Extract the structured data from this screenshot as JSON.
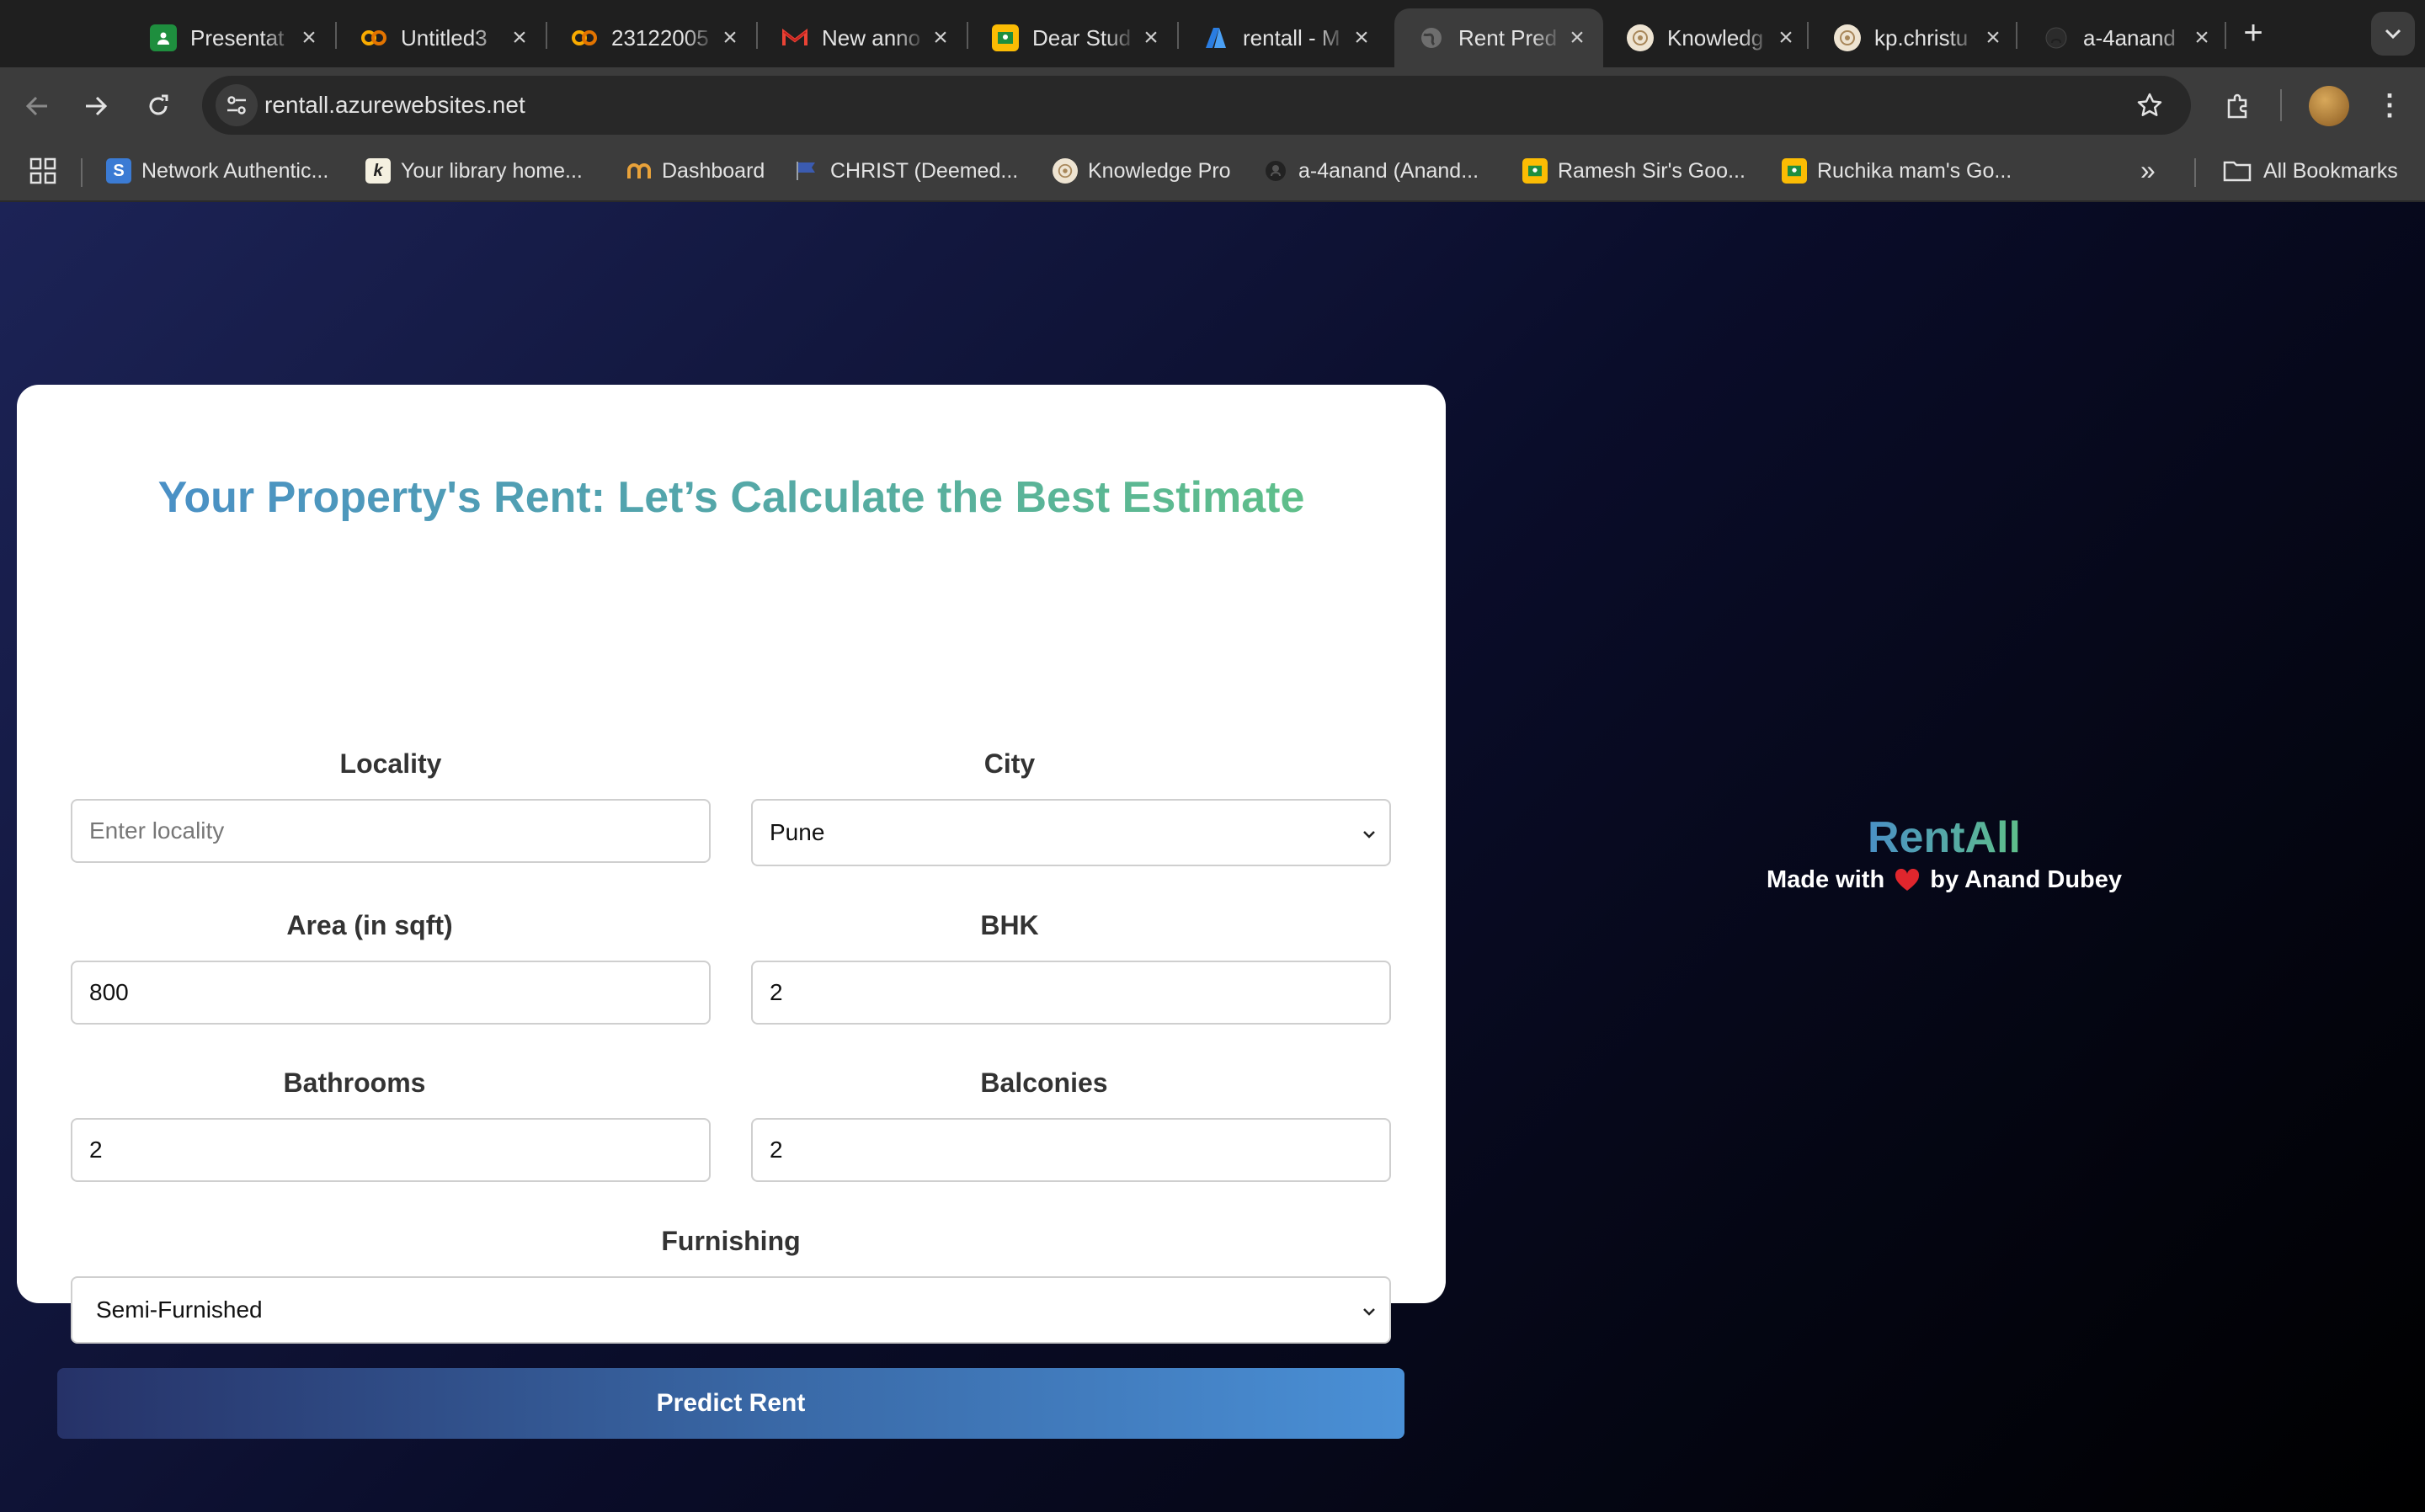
{
  "browser": {
    "tabs": [
      {
        "title": "Presentat",
        "icon": "google-slides-icon",
        "color": "#1e8e3e"
      },
      {
        "title": "Untitled3",
        "icon": "colab-icon",
        "color": "#f9ab00"
      },
      {
        "title": "23122005",
        "icon": "colab-icon",
        "color": "#f9ab00"
      },
      {
        "title": "New anno",
        "icon": "gmail-icon",
        "color": "#ea4335"
      },
      {
        "title": "Dear Stud",
        "icon": "google-classroom-icon",
        "color": "#fbbc04"
      },
      {
        "title": "rentall - M",
        "icon": "azure-icon",
        "color": "#2a7de1"
      },
      {
        "title": "Rent Pred",
        "icon": "globe-icon",
        "color": "#9aa0a6"
      },
      {
        "title": "Knowledg",
        "icon": "christ-logo-icon",
        "color": "#d9c7a8"
      },
      {
        "title": "kp.christu",
        "icon": "christ-logo-icon",
        "color": "#d9c7a8"
      },
      {
        "title": "a-4anand",
        "icon": "github-icon",
        "color": "#2b2b2b"
      }
    ],
    "url": "rentall.azurewebsites.net",
    "bookmarks": [
      {
        "label": "Network Authentic...",
        "icon": "s-logo-icon",
        "color": "#3b7bd4"
      },
      {
        "label": "Your library home...",
        "icon": "k-logo-icon",
        "color": "#f4f0e0"
      },
      {
        "label": "Dashboard",
        "icon": "dashboard-logo-icon",
        "color": "#e8a23a"
      },
      {
        "label": "CHRIST (Deemed...",
        "icon": "flag-icon",
        "color": "#3b5bb0"
      },
      {
        "label": "Knowledge Pro",
        "icon": "christ-logo-icon",
        "color": "#d9c7a8"
      },
      {
        "label": "a-4anand (Anand...",
        "icon": "github-icon",
        "color": "#2b2b2b"
      },
      {
        "label": "Ramesh Sir's Goo...",
        "icon": "google-classroom-icon",
        "color": "#fbbc04"
      },
      {
        "label": "Ruchika mam's Go...",
        "icon": "google-classroom-icon",
        "color": "#fbbc04"
      }
    ],
    "all_bookmarks_label": "All Bookmarks"
  },
  "page": {
    "title": "Your Property's Rent: Let’s Calculate the Best Estimate",
    "locality": {
      "label": "Locality",
      "placeholder": "Enter locality",
      "value": ""
    },
    "city": {
      "label": "City",
      "value": "Pune"
    },
    "area": {
      "label": "Area (in sqft)",
      "value": "800"
    },
    "bhk": {
      "label": "BHK",
      "value": "2"
    },
    "bathrooms": {
      "label": "Bathrooms",
      "value": "2"
    },
    "balconies": {
      "label": "Balconies",
      "value": "2"
    },
    "furnishing": {
      "label": "Furnishing",
      "value": "Semi-Furnished"
    },
    "submit_label": "Predict Rent",
    "brand": {
      "name": "RentAll",
      "credit_prefix": "Made with",
      "credit_suffix": "by Anand Dubey"
    }
  },
  "colors": {
    "accent_gradient_start": "#4a90c6",
    "accent_gradient_end": "#5fbf8a",
    "button_gradient_start": "#263268",
    "button_gradient_end": "#4a90d6",
    "background_start": "#1c2356",
    "background_end": "#000000"
  }
}
